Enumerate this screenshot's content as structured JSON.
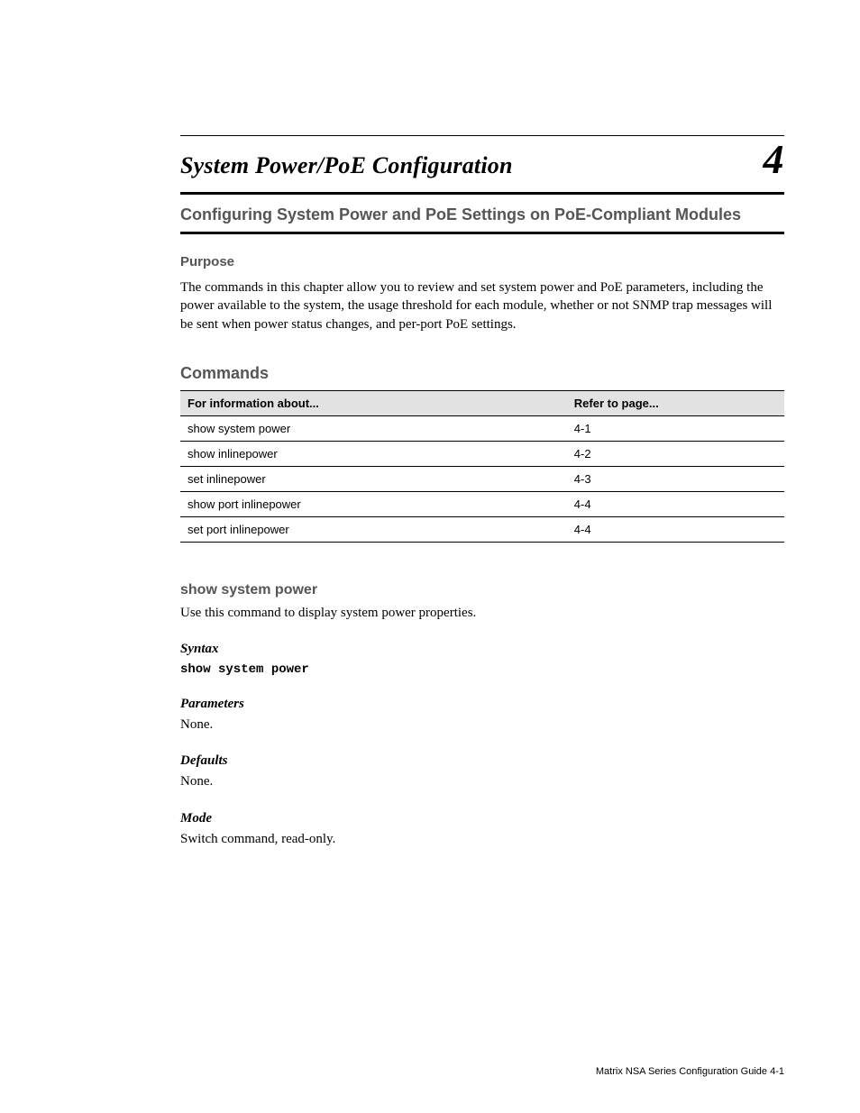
{
  "chapter": {
    "number": "4",
    "title": "System Power/PoE Configuration"
  },
  "introHeading": "Configuring System Power and PoE Settings on PoE-Compliant Modules",
  "purposeLabel": "Purpose",
  "purposeText": "The commands in this chapter allow you to review and set system power and PoE parameters, including the power available to the system, the usage threshold for each module, whether or not SNMP trap messages will be sent when power status changes, and per-port PoE settings.",
  "commandsHeading": "Commands",
  "table": {
    "headers": {
      "task": "For information about...",
      "ref": "Refer to page..."
    },
    "rows": [
      {
        "task": "show system power",
        "ref": "4-1"
      },
      {
        "task": "show inlinepower",
        "ref": "4-2"
      },
      {
        "task": "set inlinepower",
        "ref": "4-3"
      },
      {
        "task": "show port inlinepower",
        "ref": "4-4"
      },
      {
        "task": "set port inlinepower",
        "ref": "4-4"
      }
    ]
  },
  "command": {
    "name": "show system power",
    "desc": "Use this command to display system power properties.",
    "syntaxLabel": "Syntax",
    "syntax": "show system power",
    "parametersLabel": "Parameters",
    "parameters": "None.",
    "defaultsLabel": "Defaults",
    "defaults": "None.",
    "modeLabel": "Mode",
    "mode": "Switch command, read-only."
  },
  "footer": "Matrix NSA Series Configuration Guide   4-1"
}
